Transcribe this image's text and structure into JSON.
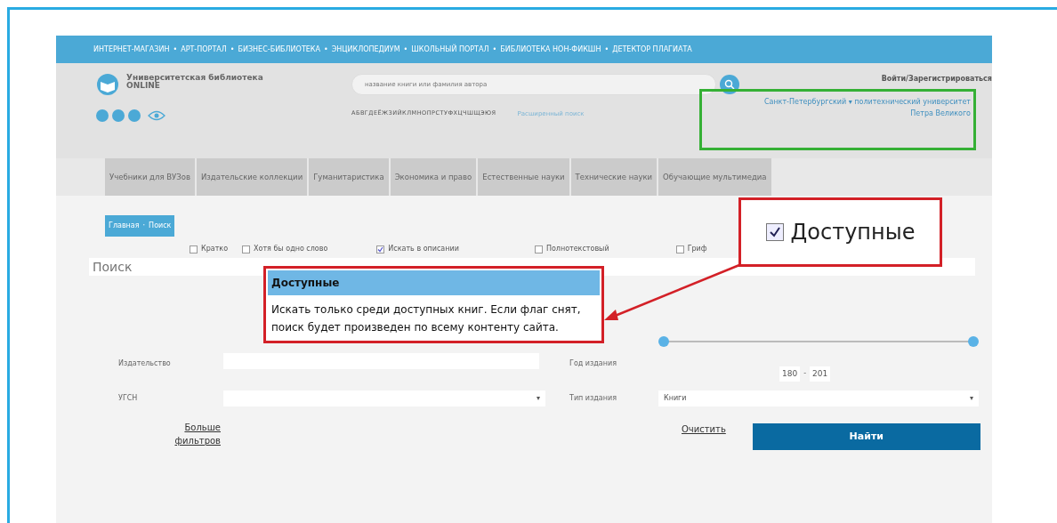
{
  "top_bar": {
    "links": [
      "ИНТЕРНЕТ-МАГАЗИН",
      "АРТ-ПОРТАЛ",
      "БИЗНЕС-БИБЛИОТЕКА",
      "ЭНЦИКЛОПЕДИУМ",
      "ШКОЛЬНЫЙ ПОРТАЛ",
      "БИБЛИОТЕКА НОН-ФИКШН",
      "ДЕТЕКТОР ПЛАГИАТА"
    ],
    "separator": "•"
  },
  "header": {
    "logo_title": "Университетская библиотека",
    "logo_subtitle": "ONLINE",
    "search_placeholder": "название книги или фамилия автора",
    "login": "Войти/Зарегистрироваться",
    "alphabet": "АБВГДЕЁЖЗИЙКЛМНОПРСТУФХЦЧШЩЭЮЯ",
    "advanced_search": "Расширенный поиск",
    "institution": "Санкт-Петербургский ▾ политехнический университет Петра Великого"
  },
  "nav_tabs": [
    "Учебники для ВУЗов",
    "Издательские коллекции",
    "Гуманитаристика",
    "Экономика и право",
    "Естественные науки",
    "Технические науки",
    "Обучающие мультимедиа"
  ],
  "breadcrumbs": {
    "items": [
      "Главная",
      "Поиск"
    ],
    "separator": "·"
  },
  "options": [
    {
      "label": "Кратко",
      "checked": false
    },
    {
      "label": "Хотя бы одно слово",
      "checked": false
    },
    {
      "label": "Искать в описании",
      "checked": true
    },
    {
      "label": "Полнотекстовый",
      "checked": false
    },
    {
      "label": "Гриф",
      "checked": false
    }
  ],
  "search": {
    "placeholder": "Поиск"
  },
  "filters": {
    "publisher_label": "Издательство",
    "year_label": "Год издания",
    "year_range": {
      "thumbs": [
        {
          "level": 0
        },
        {
          "level": 1
        }
      ],
      "from": "180",
      "dash": "-",
      "to": "201"
    },
    "ugsn_label": "УГСН",
    "ugsn_caret": "▾",
    "type_label": "Тип издания",
    "type_value": "Книги",
    "type_caret": "▾"
  },
  "buttons": {
    "more_filters": "Больше фильтров",
    "clear": "Очистить",
    "find": "Найти"
  },
  "callout": {
    "label": "Доступные",
    "checked": true
  },
  "tooltip": {
    "title": "Доступные",
    "text": "Искать только среди доступных книг. Если флаг снят, поиск будет произведен по всему контенту сайта."
  }
}
